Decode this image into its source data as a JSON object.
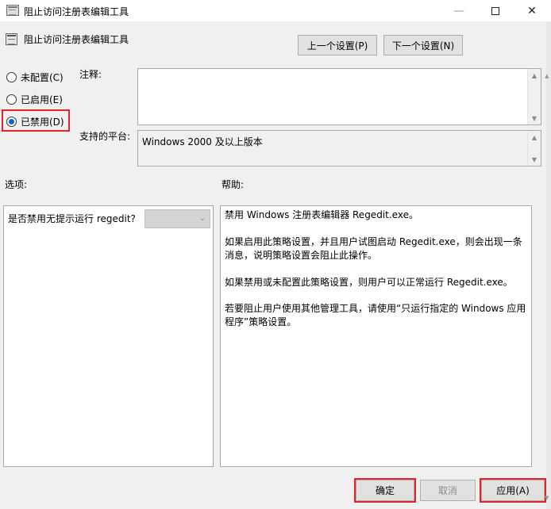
{
  "window": {
    "title": "阻止访问注册表编辑工具",
    "policy_title": "阻止访问注册表编辑工具",
    "minimize_glyph": "—",
    "close_glyph": "✕"
  },
  "nav": {
    "prev_label": "上一个设置(P)",
    "next_label": "下一个设置(N)"
  },
  "state": {
    "options": [
      "未配置(C)",
      "已启用(E)",
      "已禁用(D)"
    ],
    "selected": "已禁用(D)"
  },
  "labels": {
    "comment": "注释:",
    "platform": "支持的平台:",
    "options": "选项:",
    "help": "帮助:"
  },
  "platform_value": "Windows 2000 及以上版本",
  "option_setting": {
    "text": "是否禁用无提示运行 regedit?",
    "chevron": "⌄"
  },
  "help": [
    "禁用 Windows 注册表编辑器 Regedit.exe。",
    "如果启用此策略设置，并且用户试图启动 Regedit.exe，则会出现一条消息，说明策略设置会阻止此操作。",
    "如果禁用或未配置此策略设置，则用户可以正常运行 Regedit.exe。",
    "若要阻止用户使用其他管理工具，请使用“只运行指定的 Windows 应用程序”策略设置。"
  ],
  "buttons": {
    "ok": "确定",
    "cancel": "取消",
    "apply": "应用(A)"
  },
  "scroll_glyphs": {
    "up": "▲",
    "down": "▼"
  },
  "colors": {
    "highlight": "#e0242b",
    "radio_accent": "#0a63d8"
  }
}
